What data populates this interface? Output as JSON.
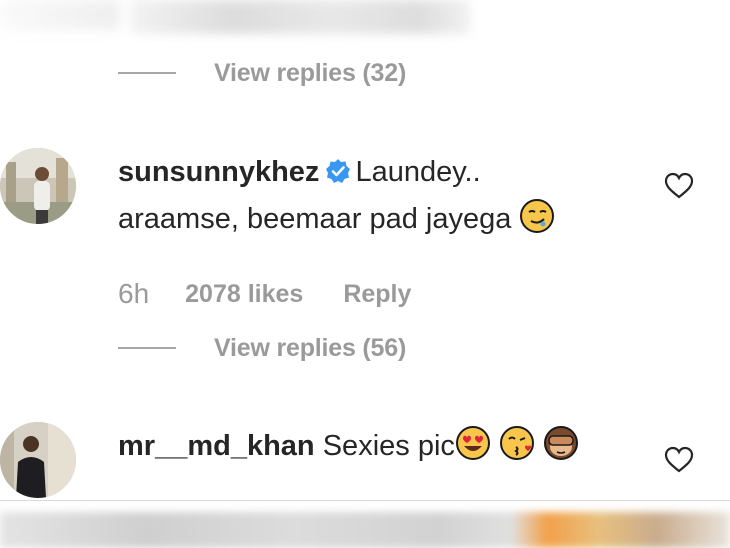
{
  "top_thread": {
    "view_replies_label": "View replies (32)"
  },
  "comments": [
    {
      "username": "sunsunnykhez",
      "verified": true,
      "text_line1": "Laundey..",
      "text_line2": "araamse, beemaar pad jayega",
      "emoji": "drooling-face-emoji",
      "time": "6h",
      "likes": "2078 likes",
      "reply_label": "Reply",
      "view_replies_label": "View replies (56)"
    },
    {
      "username": "mr__md_khan",
      "verified": false,
      "text": "Sexies pic",
      "emojis": [
        "heart-eyes-emoji",
        "kissing-face-emoji",
        "see-no-evil-monkey-emoji"
      ]
    }
  ],
  "colors": {
    "text": "#262626",
    "secondary": "#9a9a9a",
    "verified_blue": "#3897f0",
    "divider": "#dbdbdb"
  }
}
